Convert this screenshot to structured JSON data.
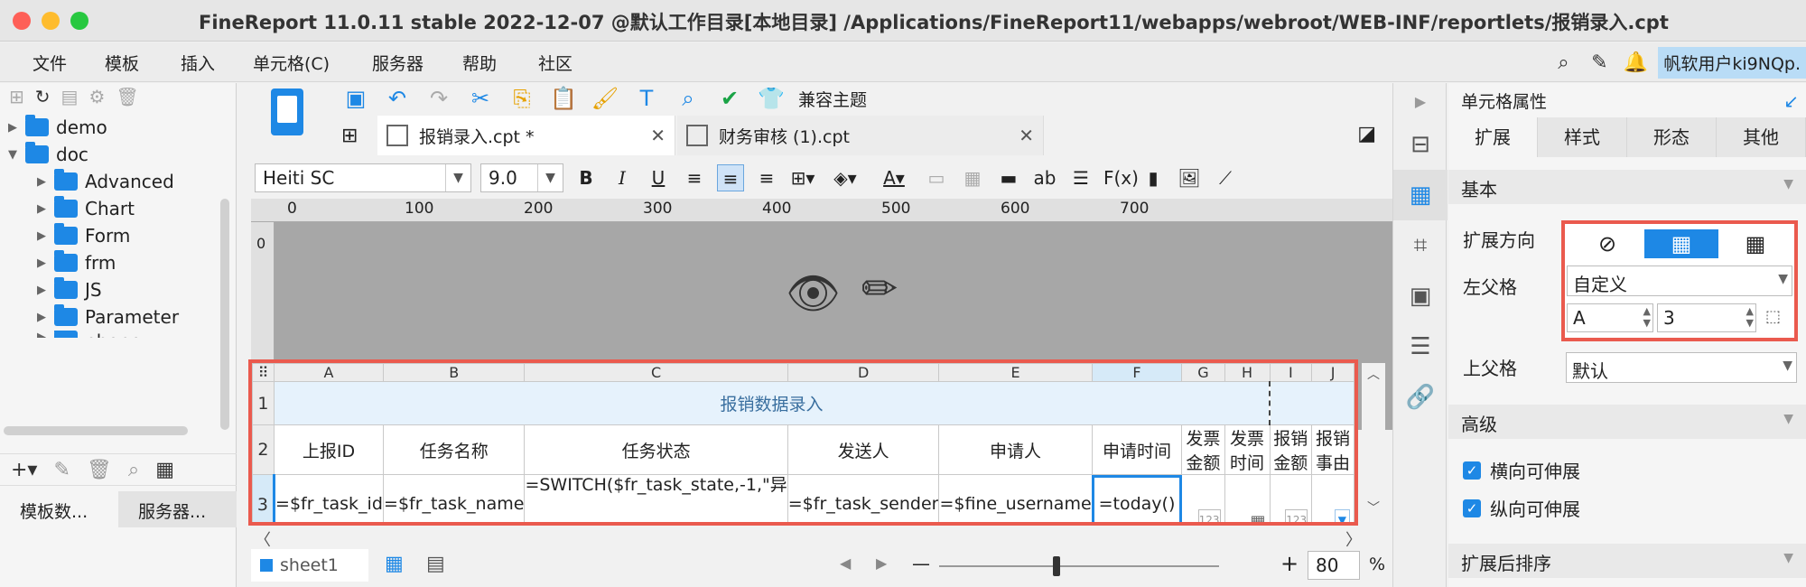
{
  "window": {
    "title": "FineReport 11.0.11 stable 2022-12-07 @默认工作目录[本地目录]   /Applications/FineReport11/webapps/webroot/WEB-INF/reportlets/报销录入.cpt"
  },
  "menu": {
    "items": [
      "文件",
      "模板",
      "插入",
      "单元格(C)",
      "服务器",
      "帮助",
      "社区"
    ],
    "user": "帆软用户ki9NQp."
  },
  "left_panel": {
    "tree": [
      {
        "label": "demo",
        "level": 0,
        "expanded": false
      },
      {
        "label": "doc",
        "level": 0,
        "expanded": true
      },
      {
        "label": "Advanced",
        "level": 1,
        "expanded": false
      },
      {
        "label": "Chart",
        "level": 1,
        "expanded": false
      },
      {
        "label": "Form",
        "level": 1,
        "expanded": false
      },
      {
        "label": "frm",
        "level": 1,
        "expanded": false
      },
      {
        "label": "JS",
        "level": 1,
        "expanded": false
      },
      {
        "label": "Parameter",
        "level": 1,
        "expanded": false
      },
      {
        "label": "phone",
        "level": 1,
        "expanded": false
      }
    ],
    "tabs": [
      "模板数...",
      "服务器..."
    ]
  },
  "toolbar": {
    "compat_theme": "兼容主题"
  },
  "tabs": [
    {
      "label": "报销录入.cpt *",
      "active": true
    },
    {
      "label": "财务审核 (1).cpt",
      "active": false
    }
  ],
  "format": {
    "font": "Heiti SC",
    "size": "9.0",
    "ab": "ab",
    "fx": "F(x)"
  },
  "ruler": [
    "0",
    "100",
    "200",
    "300",
    "400",
    "500",
    "600",
    "700"
  ],
  "vruler": "0",
  "grid": {
    "columns": [
      "A",
      "B",
      "C",
      "D",
      "E",
      "F",
      "G",
      "H",
      "I",
      "J"
    ],
    "rows": [
      "1",
      "2",
      "3"
    ],
    "title": "报销数据录入",
    "headers": [
      "上报ID",
      "任务名称",
      "任务状态",
      "发送人",
      "申请人",
      "申请时间",
      "发票金额",
      "发票时间",
      "报销金额",
      "报销事由"
    ],
    "data": [
      "=$fr_task_id",
      "=$fr_task_name",
      "=SWITCH($fr_task_state,-1,\"异",
      "=$fr_task_sender",
      "=$fine_username",
      "=today()",
      "",
      "",
      "",
      ""
    ],
    "badge_123": "123",
    "selected_col": "F",
    "selected_row": "3"
  },
  "bottom": {
    "sheet": "sheet1",
    "zoom": "80",
    "percent": "%",
    "minus": "—",
    "plus": "+"
  },
  "right_panel": {
    "title": "单元格属性",
    "tabs": [
      "扩展",
      "样式",
      "形态",
      "其他"
    ],
    "section_basic": "基本",
    "expand_dir_label": "扩展方向",
    "left_parent_label": "左父格",
    "left_parent_value": "自定义",
    "left_parent_col": "A",
    "left_parent_row": "3",
    "up_parent_label": "上父格",
    "up_parent_value": "默认",
    "section_adv": "高级",
    "h_stretch": "横向可伸展",
    "v_stretch": "纵向可伸展",
    "section_sort": "扩展后排序"
  },
  "colors": {
    "accent": "#1e88e5",
    "highlight": "#ea5a4e"
  }
}
